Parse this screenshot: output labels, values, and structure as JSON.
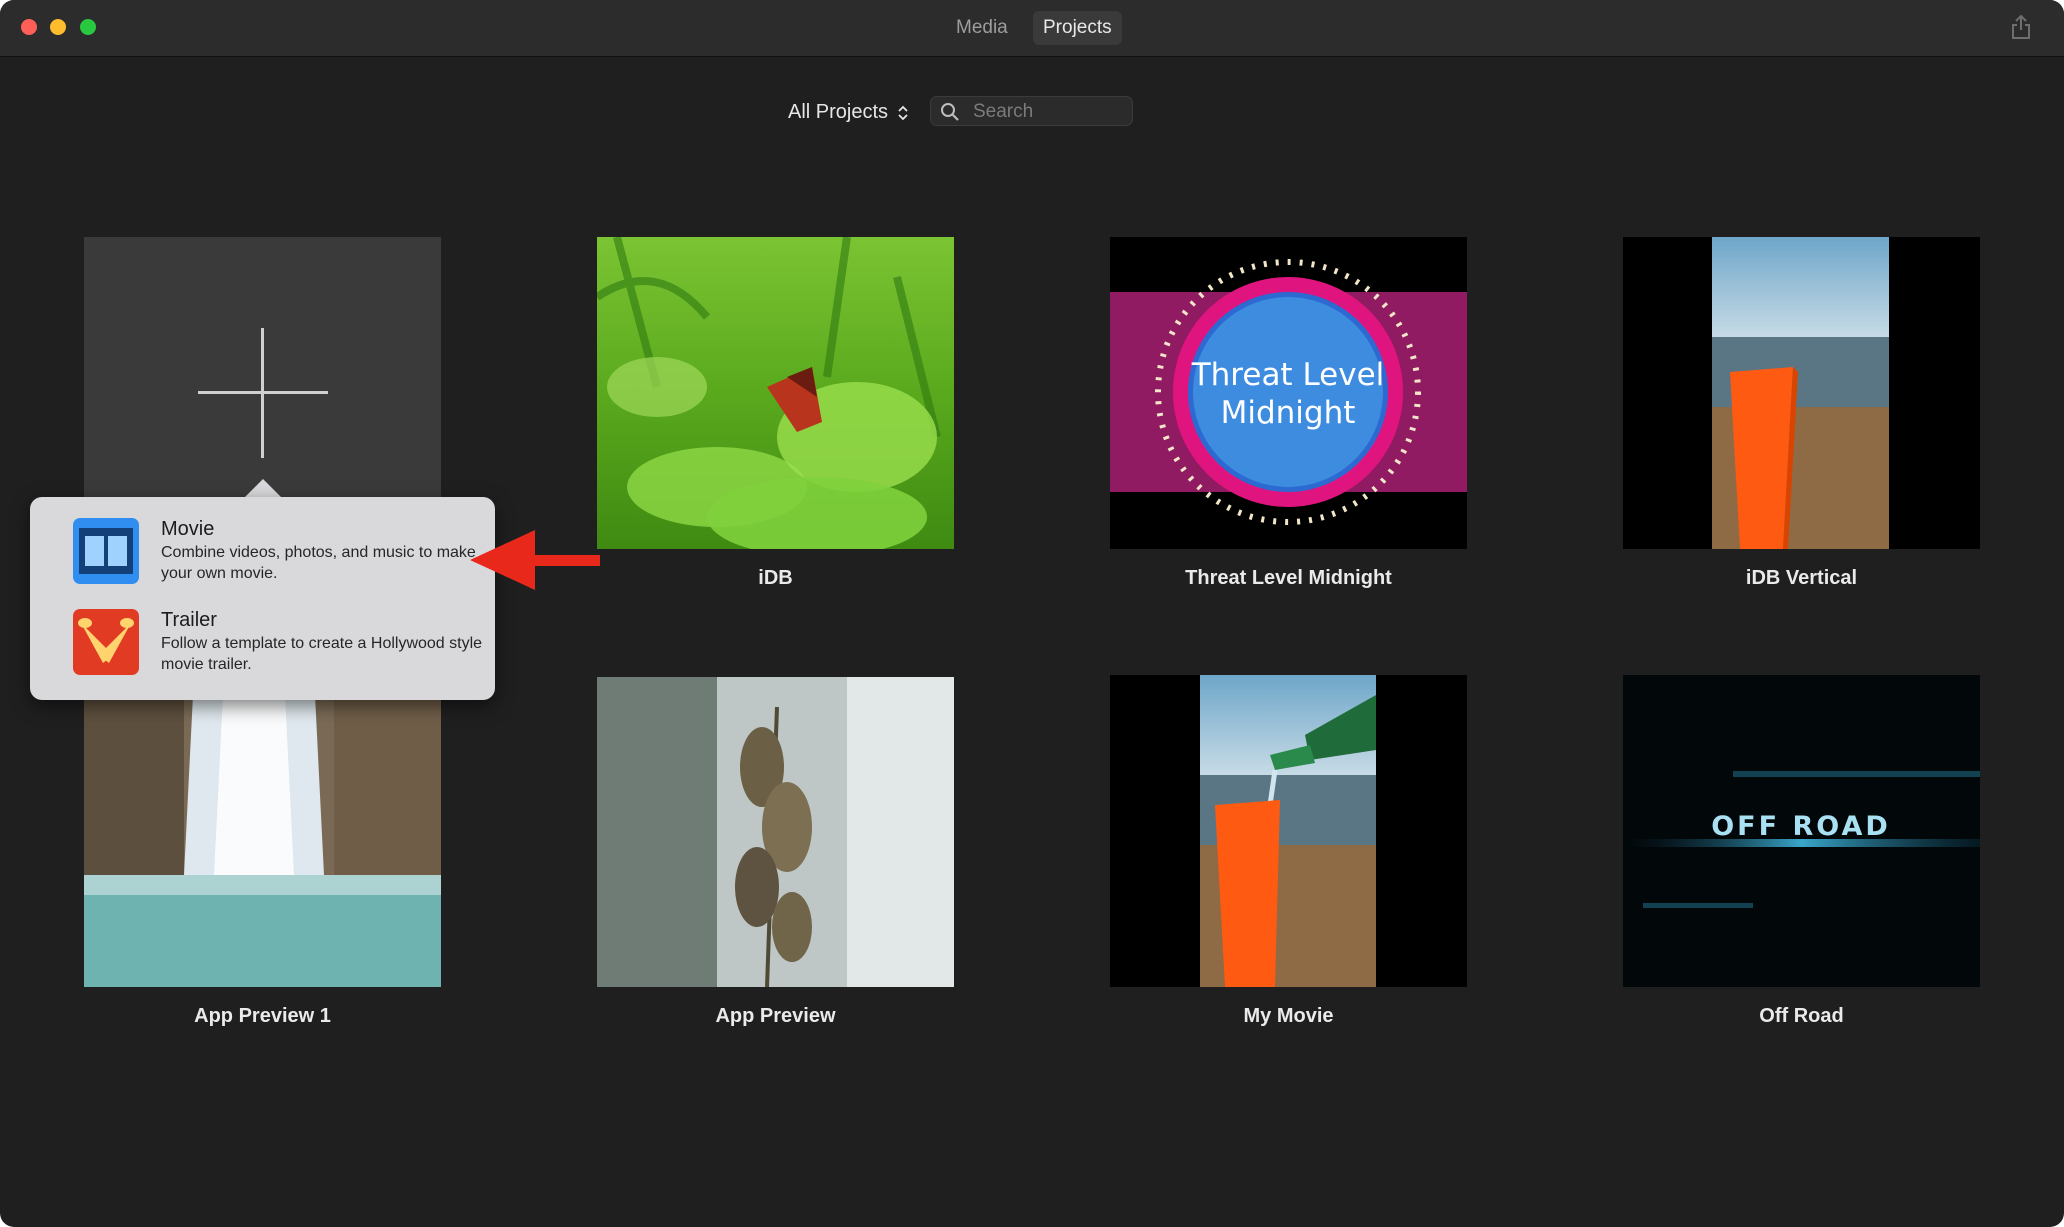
{
  "toolbar": {
    "tabs": [
      {
        "label": "Media",
        "selected": false
      },
      {
        "label": "Projects",
        "selected": true
      }
    ],
    "share_icon": "share-icon"
  },
  "filter": {
    "label": "All Projects",
    "icon": "chevron-updown-icon"
  },
  "search": {
    "placeholder": "Search",
    "value": "",
    "icon": "search-icon"
  },
  "projects": [
    {
      "name": "iDB"
    },
    {
      "name": "Threat Level Midnight",
      "thumb_text_line1": "Threat Level",
      "thumb_text_line2": "Midnight"
    },
    {
      "name": "iDB Vertical"
    },
    {
      "name": "App Preview 1"
    },
    {
      "name": "App Preview"
    },
    {
      "name": "My Movie"
    },
    {
      "name": "Off Road",
      "thumb_text": "OFF ROAD"
    }
  ],
  "new_project_popover": {
    "items": [
      {
        "title": "Movie",
        "description": "Combine videos, photos, and music to make your own movie.",
        "icon": "film-strip-icon"
      },
      {
        "title": "Trailer",
        "description": "Follow a template to create a Hollywood style movie trailer.",
        "icon": "trailer-spotlight-icon"
      }
    ]
  },
  "colors": {
    "accent_arrow": "#e8281b",
    "background": "#1f1f1f"
  }
}
